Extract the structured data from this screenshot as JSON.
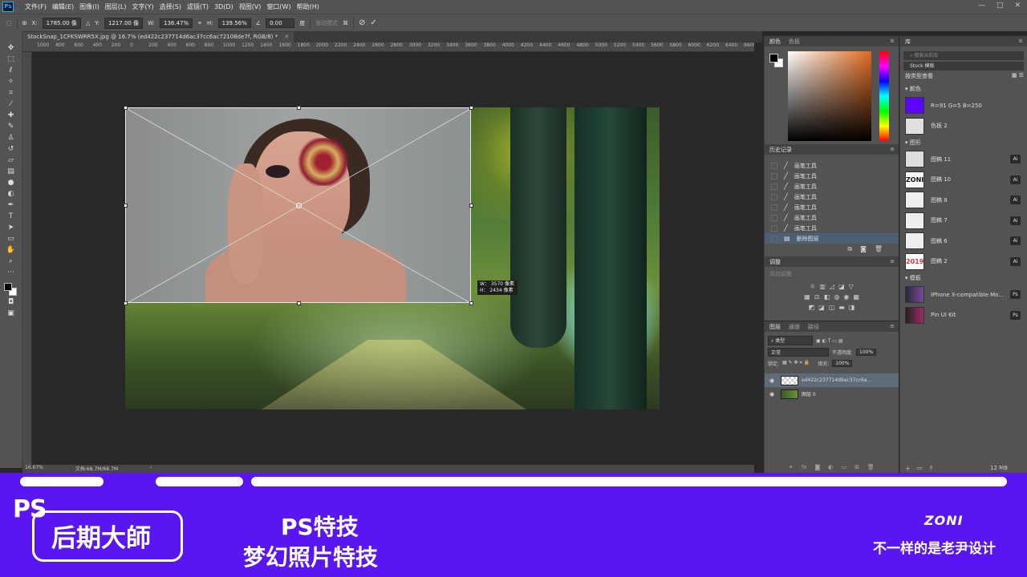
{
  "app": {
    "logo": "Ps"
  },
  "menu": [
    "文件(F)",
    "编辑(E)",
    "图像(I)",
    "图层(L)",
    "文字(Y)",
    "选择(S)",
    "滤镜(T)",
    "3D(D)",
    "视图(V)",
    "窗口(W)",
    "帮助(H)"
  ],
  "window_controls": [
    "—",
    "□",
    "✕"
  ],
  "options_bar": {
    "x_label": "X:",
    "x_value": "1785.00 像",
    "y_label": "Y:",
    "y_value": "1217.00 像",
    "w_label": "W:",
    "w_value": "136.47%",
    "h_label": "H:",
    "h_value": "139.56%",
    "angle_value": "0.00",
    "angle_unit": "度",
    "interp_label": "渐动模式"
  },
  "document_tab": {
    "title": "StockSnap_1CFKSWRR5X.jpg @ 16.7% (ed422c237714d6ac37cc6ac72108de7f, RGB/8) *",
    "close": "✕"
  },
  "ruler_ticks": [
    "1000",
    "800",
    "600",
    "400",
    "200",
    "0",
    "200",
    "400",
    "600",
    "800",
    "1000",
    "1200",
    "1400",
    "1600",
    "1800",
    "2000",
    "2200",
    "2400",
    "2600",
    "2800",
    "3000",
    "3200",
    "3400",
    "3600",
    "3800",
    "4000",
    "4200",
    "4400",
    "4600",
    "4800",
    "5000",
    "5200",
    "5400",
    "5600",
    "5800",
    "6000",
    "6200",
    "6400",
    "6600",
    "6800",
    "7000",
    "7200",
    "7400",
    "7600"
  ],
  "size_tooltip": {
    "w": "W： 3570 像素",
    "h": "H： 2434 像素"
  },
  "status": {
    "zoom": "16.67%",
    "doc": "文档:68.7M/68.7M",
    "arrow": "›"
  },
  "color_panel": {
    "tabs": [
      "颜色",
      "色板"
    ]
  },
  "history_panel": {
    "title": "历史记录",
    "items": [
      "画笔工具",
      "画笔工具",
      "画笔工具",
      "画笔工具",
      "画笔工具",
      "画笔工具",
      "画笔工具",
      "删除图层"
    ]
  },
  "adjust_panel": {
    "title": "调整",
    "hint": "添加调整"
  },
  "layers_panel": {
    "tabs": [
      "图层",
      "通道",
      "路径"
    ],
    "filter": "类型",
    "blend": "正常",
    "opacity_label": "不透明度:",
    "opacity": "100%",
    "lock_label": "锁定:",
    "fill_label": "填充:",
    "fill": "100%",
    "layers": [
      {
        "name": "ed422c237714d6ac37cc6a...",
        "selected": true
      },
      {
        "name": "图层 0",
        "selected": false
      }
    ]
  },
  "library_panel": {
    "tab": "库",
    "search_placeholder": "搜索当前库",
    "library_select": "Stock 模板",
    "view_label": "按类型查看",
    "sections": {
      "colors": "颜色",
      "graphics": "图形",
      "templates": "模板"
    },
    "colors": [
      {
        "label": "R=91 G=5 B=250",
        "hex": "#5b05fa"
      },
      {
        "label": "色板 2",
        "hex": "#e0e0e0"
      }
    ],
    "graphics": [
      {
        "label": "图稿 11",
        "badge": "Ai"
      },
      {
        "label": "图稿 10",
        "badge": "Ai",
        "thumb_text": "ZONI"
      },
      {
        "label": "图稿 8",
        "badge": "Ai"
      },
      {
        "label": "图稿 7",
        "badge": "Ai"
      },
      {
        "label": "图稿 6",
        "badge": "Ai"
      },
      {
        "label": "图稿 2",
        "badge": "Ai",
        "thumb_text": "2019"
      }
    ],
    "templates": [
      {
        "label": "iPhone X-compatible Mo...",
        "badge": "Ps"
      },
      {
        "label": "Pin UI Kit",
        "badge": "Ps"
      }
    ],
    "footer_size": "12 MB"
  },
  "banner": {
    "ps": "PS",
    "brand_box": "后期大師",
    "title1": "PS特技",
    "title2": "梦幻照片特技",
    "zoni": "ZONI",
    "slogan": "不一样的是老尹设计",
    "color": "#5a16f0"
  }
}
